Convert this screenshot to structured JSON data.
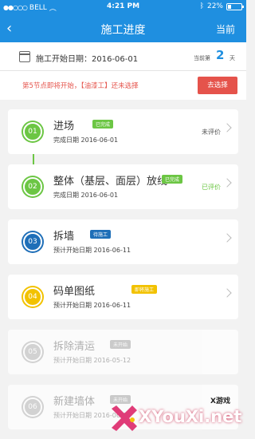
{
  "status_bar": {
    "carrier": "BELL",
    "time": "4:21 PM",
    "battery": "22%"
  },
  "nav": {
    "back_label": "‹",
    "title": "施工进度",
    "right_label": "当前"
  },
  "info_bar": {
    "start_date": "施工开始日期：2016-06-01",
    "current_label": "当前第",
    "current_day": "2",
    "current_unit": "天"
  },
  "notice": {
    "text": "第5节点即将开始，【油漆工】还未选择",
    "button": "去选择"
  },
  "steps": [
    {
      "num": "01",
      "name": "进场",
      "badge": "已完成",
      "date": "完成日期 2016-06-01",
      "status": "未评价",
      "color": "#6cc644",
      "badge_color": "#6cc644",
      "status_color": "#555",
      "dim": false
    },
    {
      "num": "02",
      "name": "整体（基层、面层）放线",
      "badge": "已完成",
      "date": "完成日期 2016-06-01",
      "status": "已评价",
      "color": "#6cc644",
      "badge_color": "#6cc644",
      "status_color": "#6cc644",
      "dim": false
    },
    {
      "num": "03",
      "name": "拆墙",
      "badge": "待施工",
      "date": "预计开始日期 2016-06-11",
      "status": "",
      "color": "#1f6fb8",
      "badge_color": "#1f6fb8",
      "status_color": "#555",
      "dim": false
    },
    {
      "num": "04",
      "name": "码单图纸",
      "badge": "即将施工",
      "date": "预计开始日期 2016-06-11",
      "status": "",
      "color": "#f2c200",
      "badge_color": "#f2c200",
      "status_color": "#555",
      "dim": false
    },
    {
      "num": "05",
      "name": "拆除清运",
      "badge": "未开始",
      "date": "预计开始日期 2016-05-12",
      "status": "",
      "color": "#c8c8c8",
      "badge_color": "#bdbdbd",
      "status_color": "#555",
      "dim": true
    },
    {
      "num": "06",
      "name": "新建墙体",
      "badge": "未开始",
      "date": "预计开始日期 2016-06-11",
      "status": "",
      "color": "#c8c8c8",
      "badge_color": "#bdbdbd",
      "status_color": "#555",
      "dim": true
    }
  ],
  "watermark": {
    "text": "XYouXi.net",
    "sub": "X游戏"
  }
}
